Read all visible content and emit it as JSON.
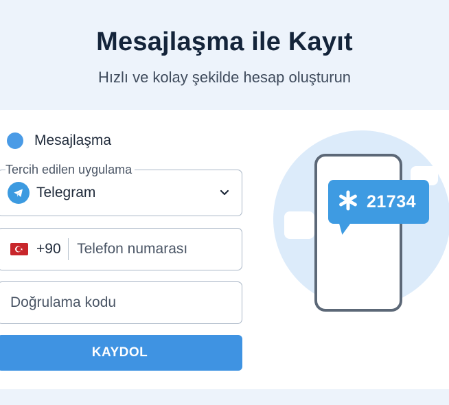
{
  "header": {
    "title": "Mesajlaşma ile Kayıt",
    "subtitle": "Hızlı ve kolay şekilde hesap oluşturun"
  },
  "method": {
    "label": "Mesajlaşma",
    "selected": true
  },
  "app_select": {
    "label": "Tercih edilen uygulama",
    "value": "Telegram",
    "icon": "telegram-icon"
  },
  "phone": {
    "country_code": "+90",
    "flag": "turkey-flag-icon",
    "placeholder": "Telefon numarası"
  },
  "verification": {
    "placeholder": "Doğrulama kodu"
  },
  "submit": {
    "label": "KAYDOL"
  },
  "illustration": {
    "code": "21734",
    "icon": "asterisk-icon"
  },
  "colors": {
    "accent": "#3f93e2",
    "background": "#edf3fb",
    "card": "#ffffff",
    "flag_red": "#c8262b"
  }
}
